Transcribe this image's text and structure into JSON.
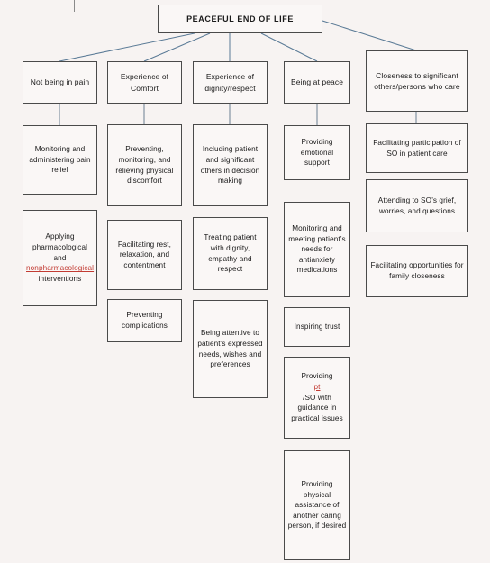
{
  "diagram": {
    "type": "hierarchy-tree",
    "title": "PEACEFUL END OF LIFE",
    "colors": {
      "background": "#f7f3f2",
      "box_fill": "#faf7f6",
      "box_border": "#4a4a4a",
      "connector": "#5a7a96",
      "spellcheck_underline": "#c23b33"
    },
    "root": {
      "label": "PEACEFUL END OF LIFE"
    },
    "branches": [
      {
        "id": "not-being-in-pain",
        "label": "Not being in pain",
        "children": [
          {
            "id": "monitoring-pain-relief",
            "label": "Monitoring and administering pain relief"
          },
          {
            "id": "applying-pharmacological",
            "label_pre": "Applying pharmacological and ",
            "label_marked": "nonpharmacological",
            "label_post": " interventions",
            "label": "Applying pharmacological and nonpharmacological interventions"
          }
        ]
      },
      {
        "id": "experience-of-comfort",
        "label": "Experience of Comfort",
        "children": [
          {
            "id": "preventing-monitoring-relieving",
            "label": "Preventing, monitoring, and relieving physical discomfort"
          },
          {
            "id": "facilitating-rest",
            "label": "Facilitating rest, relaxation, and contentment"
          },
          {
            "id": "preventing-complications",
            "label": "Preventing complications"
          }
        ]
      },
      {
        "id": "experience-of-dignity-respect",
        "label": "Experience of dignity/respect",
        "children": [
          {
            "id": "including-patient-decision",
            "label": "Including patient and significant others in decision making"
          },
          {
            "id": "treating-with-dignity",
            "label": "Treating patient with dignity, empathy and respect"
          },
          {
            "id": "being-attentive",
            "label": "Being attentive to patient’s expressed needs, wishes and preferences"
          }
        ]
      },
      {
        "id": "being-at-peace",
        "label": "Being at peace",
        "children": [
          {
            "id": "providing-emotional-support",
            "label": "Providing emotional support"
          },
          {
            "id": "monitoring-antianxiety",
            "label": "Monitoring and meeting patient’s needs for antianxiety medications"
          },
          {
            "id": "inspiring-trust",
            "label": "Inspiring trust"
          },
          {
            "id": "providing-guidance",
            "label_pre": "Providing ",
            "label_marked": "pt",
            "label_post": "/SO with guidance in practical issues",
            "label": "Providing pt/SO with guidance in practical issues"
          },
          {
            "id": "providing-physical-assistance",
            "label": "Providing physical assistance of another caring person, if desired"
          }
        ]
      },
      {
        "id": "closeness-to-significant-others",
        "label": "Closeness to significant others/persons who care",
        "children": [
          {
            "id": "facilitating-participation-so",
            "label": "Facilitating participation of SO in patient care"
          },
          {
            "id": "attending-so-grief",
            "label": "Attending to SO’s grief, worries, and questions"
          },
          {
            "id": "facilitating-family-closeness",
            "label": "Facilitating opportunities for family closeness"
          }
        ]
      }
    ]
  }
}
